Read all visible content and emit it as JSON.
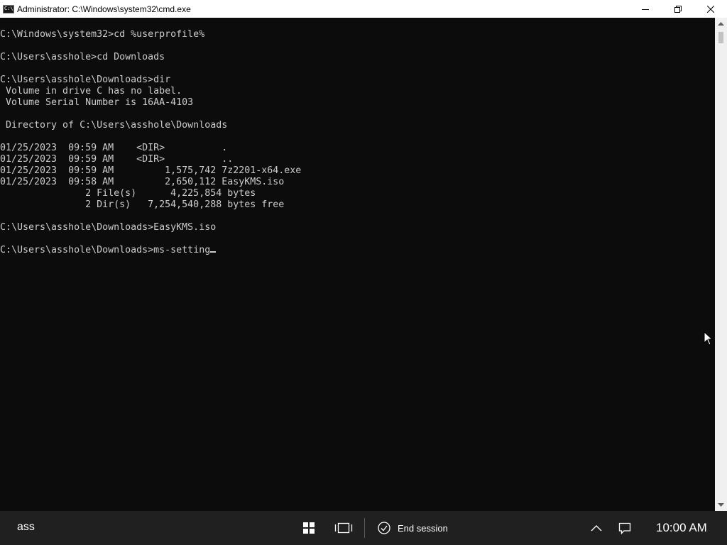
{
  "window": {
    "title": "Administrator: C:\\Windows\\system32\\cmd.exe",
    "icon": "cmd-icon",
    "icon_text": "C:\\"
  },
  "console": {
    "lines": [
      "C:\\Windows\\system32>cd %userprofile%",
      "",
      "C:\\Users\\asshole>cd Downloads",
      "",
      "C:\\Users\\asshole\\Downloads>dir",
      " Volume in drive C has no label.",
      " Volume Serial Number is 16AA-4103",
      "",
      " Directory of C:\\Users\\asshole\\Downloads",
      "",
      "01/25/2023  09:59 AM    <DIR>          .",
      "01/25/2023  09:59 AM    <DIR>          ..",
      "01/25/2023  09:59 AM         1,575,742 7z2201-x64.exe",
      "01/25/2023  09:58 AM         2,650,112 EasyKMS.iso",
      "               2 File(s)      4,225,854 bytes",
      "               2 Dir(s)   7,254,540,288 bytes free",
      "",
      "C:\\Users\\asshole\\Downloads>EasyKMS.iso",
      ""
    ],
    "prompt": "C:\\Users\\asshole\\Downloads>",
    "current_input": "ms-setting",
    "text_color": "#cccccc",
    "background": "#0c0c0c"
  },
  "taskbar": {
    "left_text": "ass",
    "end_session_label": "End session",
    "clock": "10:00 AM",
    "background": "#202020"
  }
}
